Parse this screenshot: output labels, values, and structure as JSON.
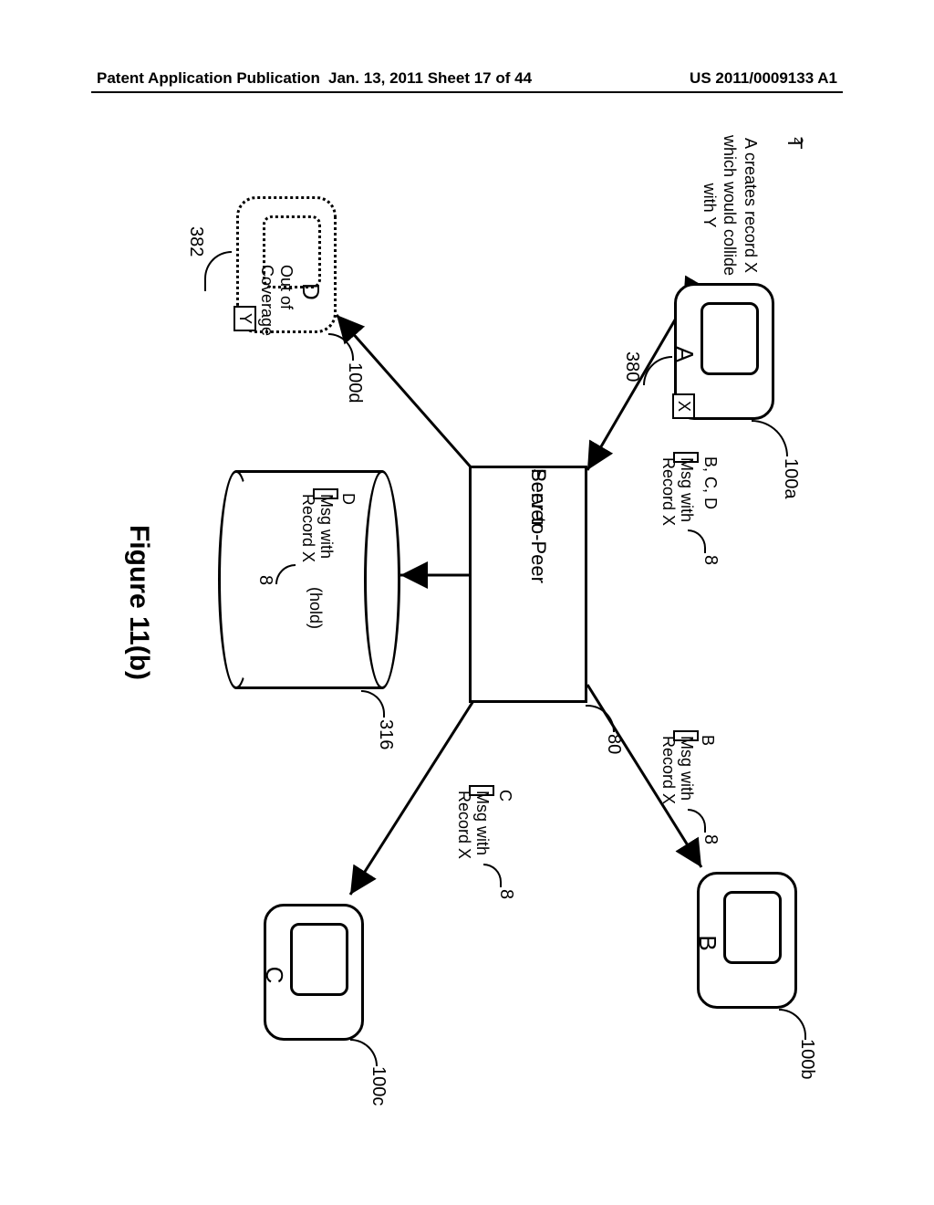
{
  "header": {
    "left": "Patent Application Publication",
    "mid": "Jan. 13, 2011  Sheet 17 of 44",
    "right": "US 2011/0009133 A1"
  },
  "timestep": "T",
  "timestep_sub": "2",
  "note_a": "A creates record X which would collide with Y",
  "devices": {
    "a": {
      "label": "A",
      "ref": "100a",
      "record": "X",
      "record_ref": "380"
    },
    "b": {
      "label": "B",
      "ref": "100b"
    },
    "c": {
      "label": "C",
      "ref": "100c"
    },
    "d": {
      "label": "D",
      "ref": "100d",
      "record": "Y",
      "record_ref": "382",
      "status_line1": "Out of",
      "status_line2": "Coverage"
    }
  },
  "server": {
    "line1": "Peer-to-Peer",
    "line2": "Server",
    "ref": "80"
  },
  "db": {
    "ref": "316"
  },
  "messages": {
    "from_a": {
      "dest": "B, C, D",
      "line1": "Msg with",
      "line2": "Record X",
      "priority": "8"
    },
    "to_b": {
      "dest": "B",
      "line1": "Msg with",
      "line2": "Record X",
      "priority": "8"
    },
    "to_c": {
      "dest": "C",
      "line1": "Msg with",
      "line2": "Record X",
      "priority": "8"
    },
    "to_d": {
      "dest": "D",
      "line1": "Msg with",
      "line2": "Record X",
      "priority": "8",
      "status": "(hold)"
    }
  },
  "figure_caption": "Figure 11(b)"
}
